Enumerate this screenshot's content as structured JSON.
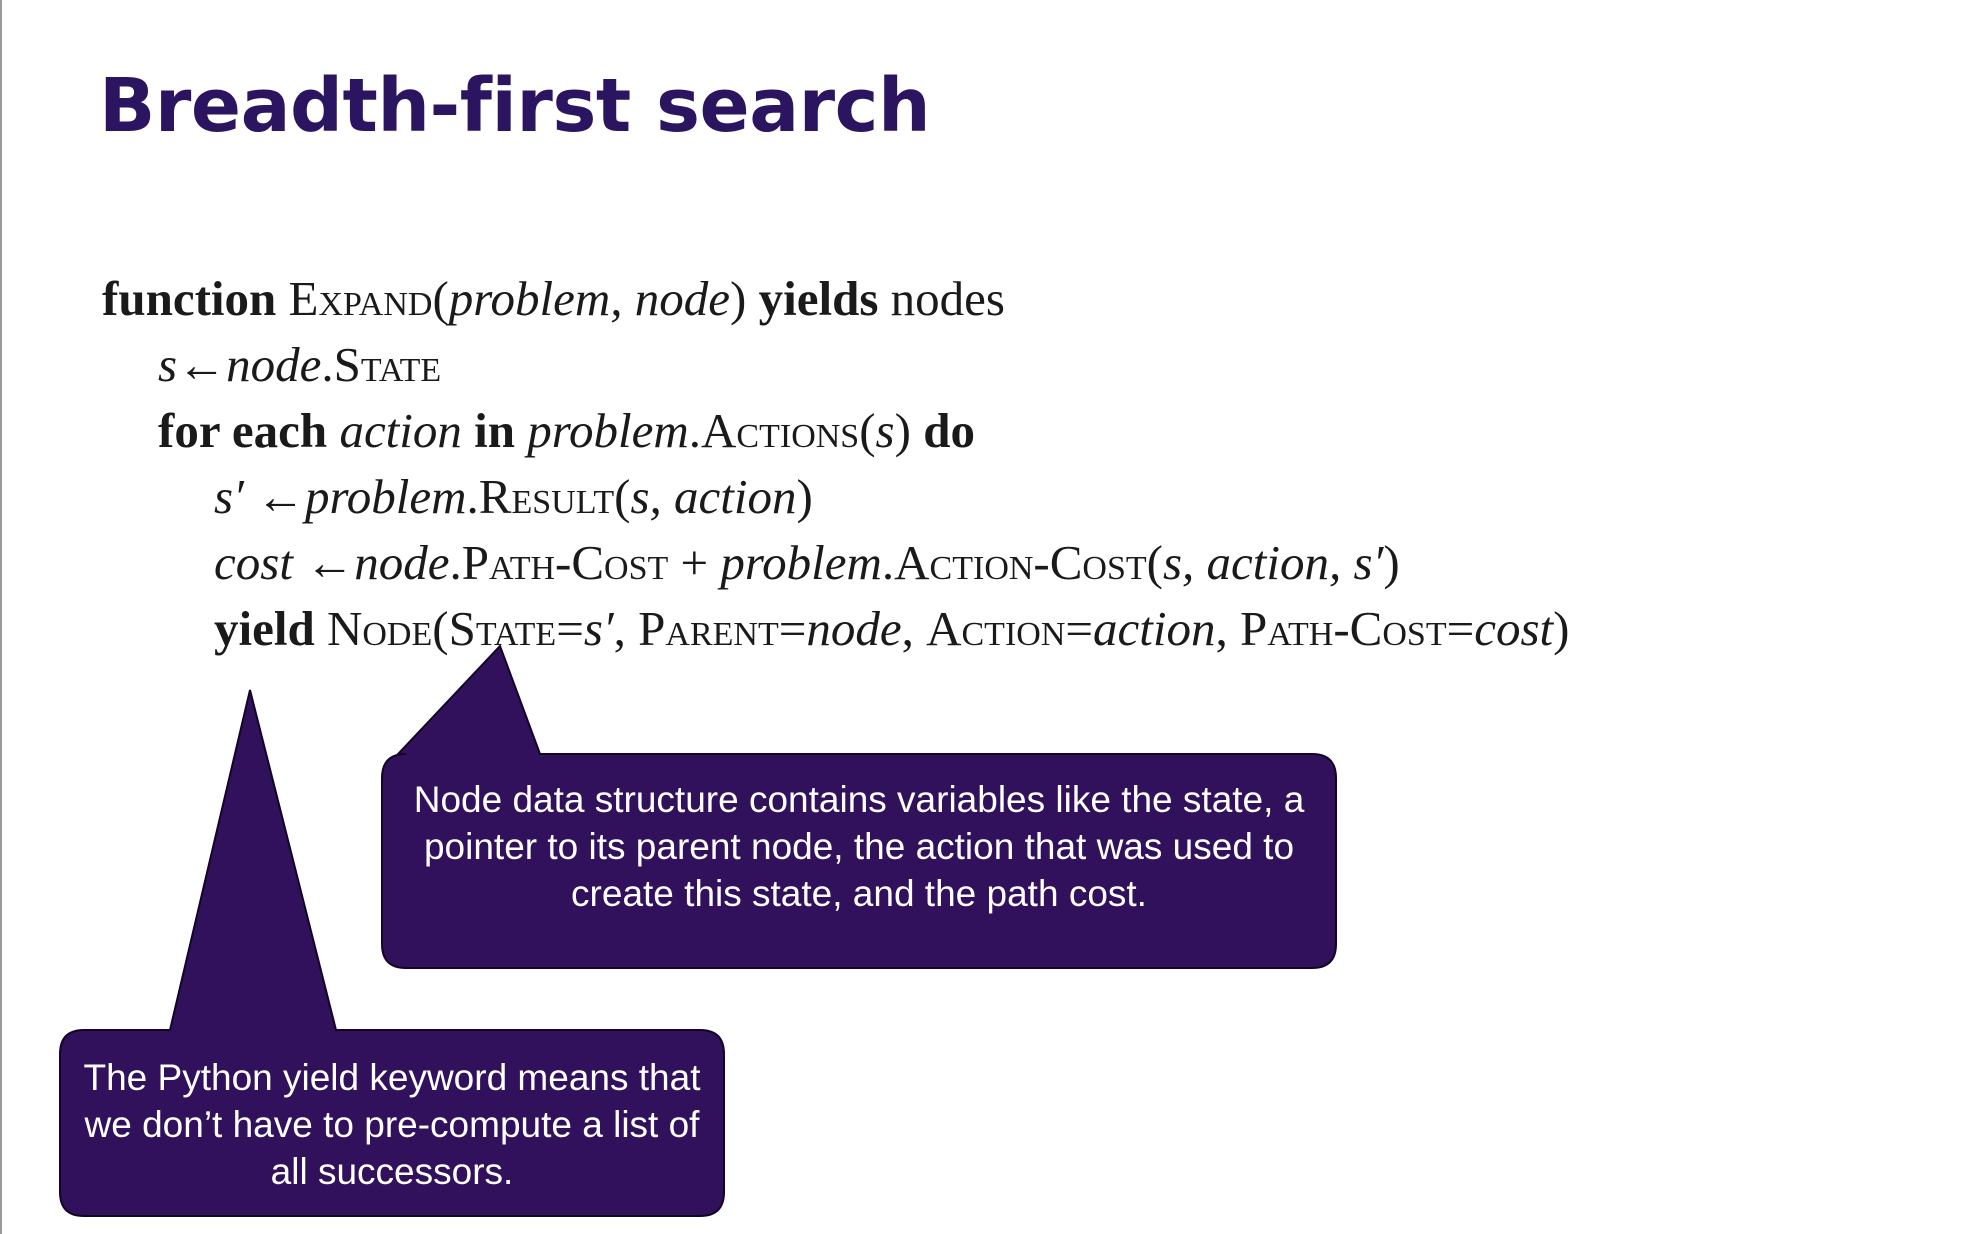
{
  "slide": {
    "title": "Breadth-first search"
  },
  "pseudocode": {
    "line1": {
      "kw_function": "function",
      "fn_name": "Expand(",
      "params": "problem, node",
      "close": ")",
      "kw_yields": "yields",
      "rest": "nodes"
    },
    "line2": {
      "var_s": "s",
      "arrow": "←",
      "node": "node",
      "dot": ".",
      "field": "State"
    },
    "line3": {
      "kw_for_each": "for each",
      "var_action": "action",
      "kw_in": "in",
      "problem": "problem",
      "dot": ".",
      "method": "Actions(",
      "arg": "s",
      "close": ")",
      "kw_do": "do"
    },
    "line4": {
      "var_s_prime": "s′",
      "arrow": "←",
      "problem": "problem",
      "dot": ".",
      "method": "Result(",
      "args": "s, action",
      "close": ")"
    },
    "line5": {
      "var_cost": "cost",
      "arrow": "←",
      "node": "node",
      "dot": ".",
      "field": "Path-Cost",
      "plus": " + ",
      "problem": "problem",
      "dot2": ".",
      "method": "Action-Cost(",
      "args": "s, action, s′",
      "close": ")"
    },
    "line6": {
      "kw_yield": "yield",
      "fn_node": "Node(",
      "state_key": "State",
      "eq1": "=",
      "state_val": "s′",
      "sep1": ", ",
      "parent_key": "Parent",
      "eq2": "=",
      "parent_val": "node",
      "sep2": ", ",
      "action_key": "Action",
      "eq3": "=",
      "action_val": "action",
      "sep3": ", ",
      "cost_key": "Path-Cost",
      "eq4": "=",
      "cost_val": "cost",
      "close": ")"
    }
  },
  "callouts": {
    "node_info": "Node data structure contains variables like the state, a pointer to its parent node, the action that was used to create this state, and the path cost.",
    "yield_info": "The Python yield keyword means that we don’t have to pre-compute a list of all successors."
  },
  "colors": {
    "title": "#2b1460",
    "callout_fill": "#31115c",
    "callout_text": "#ffffff",
    "code_text": "#1a1a1a"
  }
}
